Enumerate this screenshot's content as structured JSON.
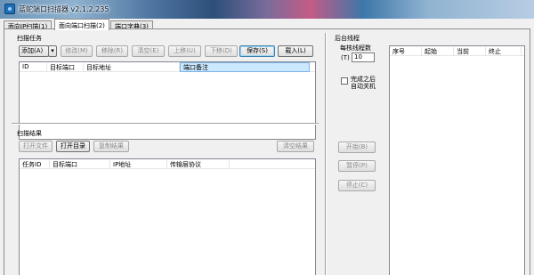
{
  "window": {
    "title": "蓝蛇端口扫描器 v2.1.2.235"
  },
  "tabs": [
    {
      "label": "面向IP扫描(1)"
    },
    {
      "label": "面向端口扫描(2)"
    },
    {
      "label": "端口字典(3)"
    }
  ],
  "scan_tasks": {
    "title": "扫描任务",
    "buttons": {
      "add": "添加(A)",
      "edit": "修改(M)",
      "remove": "移除(R)",
      "clear": "清空(E)",
      "move_up": "上移(U)",
      "move_down": "下移(D)",
      "save": "保存(S)",
      "load": "载入(L)"
    },
    "columns": [
      "ID",
      "目标端口",
      "目标地址",
      "端口备注"
    ]
  },
  "scan_results": {
    "title": "扫描结果",
    "buttons": {
      "open_file": "打开文件",
      "open_dir": "打开目录",
      "copy_results": "复制结果",
      "clear_results": "清空结果"
    },
    "columns": [
      "任务ID",
      "目标端口",
      "IP地址",
      "传输层协议"
    ]
  },
  "background_threads": {
    "title": "后台线程",
    "per_task_threads_label": "每核线程数",
    "threads_key": "(T)",
    "threads_value": "10",
    "shutdown_checkbox_line1": "完成之后",
    "shutdown_checkbox_line2": "自动关机",
    "buttons": {
      "start": "开始(B)",
      "pause": "暂停(P)",
      "stop": "停止(C)"
    },
    "columns": [
      "序号",
      "起始",
      "当前",
      "终止"
    ]
  },
  "colors": {
    "accent": "#3c7fb1",
    "selected_header": "#cce8ff"
  }
}
